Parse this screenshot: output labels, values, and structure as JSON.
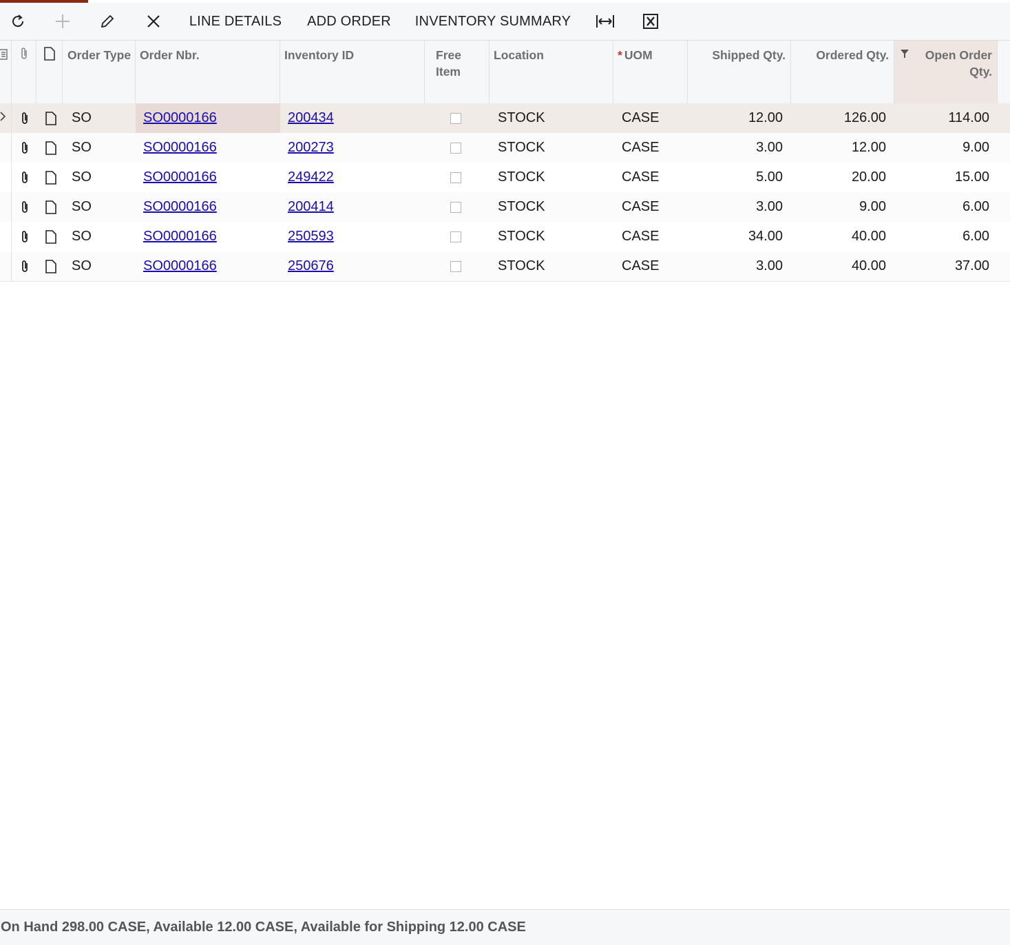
{
  "toolbar": {
    "refresh_icon": "refresh-icon",
    "add_icon": "plus-icon",
    "edit_icon": "pencil-icon",
    "delete_icon": "close-icon",
    "line_details": "LINE DETAILS",
    "add_order": "ADD ORDER",
    "inventory_summary": "INVENTORY SUMMARY",
    "fit_icon": "fit-to-screen-icon",
    "export_icon": "excel-export-icon"
  },
  "grid": {
    "headers": {
      "order_type": "Order Type",
      "order_nbr": "Order Nbr.",
      "inventory_id": "Inventory ID",
      "free_item": "Free Item",
      "location": "Location",
      "uom_required": "*",
      "uom": "UOM",
      "shipped_qty": "Shipped Qty.",
      "ordered_qty": "Ordered Qty.",
      "open_order_qty": "Open Order Qty."
    },
    "rows": [
      {
        "order_type": "SO",
        "order_nbr": "SO0000166",
        "inventory_id": "200434",
        "free_item": false,
        "location": "STOCK",
        "uom": "CASE",
        "shipped_qty": "12.00",
        "ordered_qty": "126.00",
        "open_order_qty": "114.00"
      },
      {
        "order_type": "SO",
        "order_nbr": "SO0000166",
        "inventory_id": "200273",
        "free_item": false,
        "location": "STOCK",
        "uom": "CASE",
        "shipped_qty": "3.00",
        "ordered_qty": "12.00",
        "open_order_qty": "9.00"
      },
      {
        "order_type": "SO",
        "order_nbr": "SO0000166",
        "inventory_id": "249422",
        "free_item": false,
        "location": "STOCK",
        "uom": "CASE",
        "shipped_qty": "5.00",
        "ordered_qty": "20.00",
        "open_order_qty": "15.00"
      },
      {
        "order_type": "SO",
        "order_nbr": "SO0000166",
        "inventory_id": "200414",
        "free_item": false,
        "location": "STOCK",
        "uom": "CASE",
        "shipped_qty": "3.00",
        "ordered_qty": "9.00",
        "open_order_qty": "6.00"
      },
      {
        "order_type": "SO",
        "order_nbr": "SO0000166",
        "inventory_id": "250593",
        "free_item": false,
        "location": "STOCK",
        "uom": "CASE",
        "shipped_qty": "34.00",
        "ordered_qty": "40.00",
        "open_order_qty": "6.00"
      },
      {
        "order_type": "SO",
        "order_nbr": "SO0000166",
        "inventory_id": "250676",
        "free_item": false,
        "location": "STOCK",
        "uom": "CASE",
        "shipped_qty": "3.00",
        "ordered_qty": "40.00",
        "open_order_qty": "37.00"
      }
    ]
  },
  "footer": {
    "status": "On Hand 298.00 CASE, Available 12.00 CASE, Available for Shipping 12.00 CASE"
  },
  "colors": {
    "accent": "#8a2a12",
    "link": "#1a0dab",
    "active_row": "#f1ebe8",
    "required_marker": "#c0392b"
  }
}
